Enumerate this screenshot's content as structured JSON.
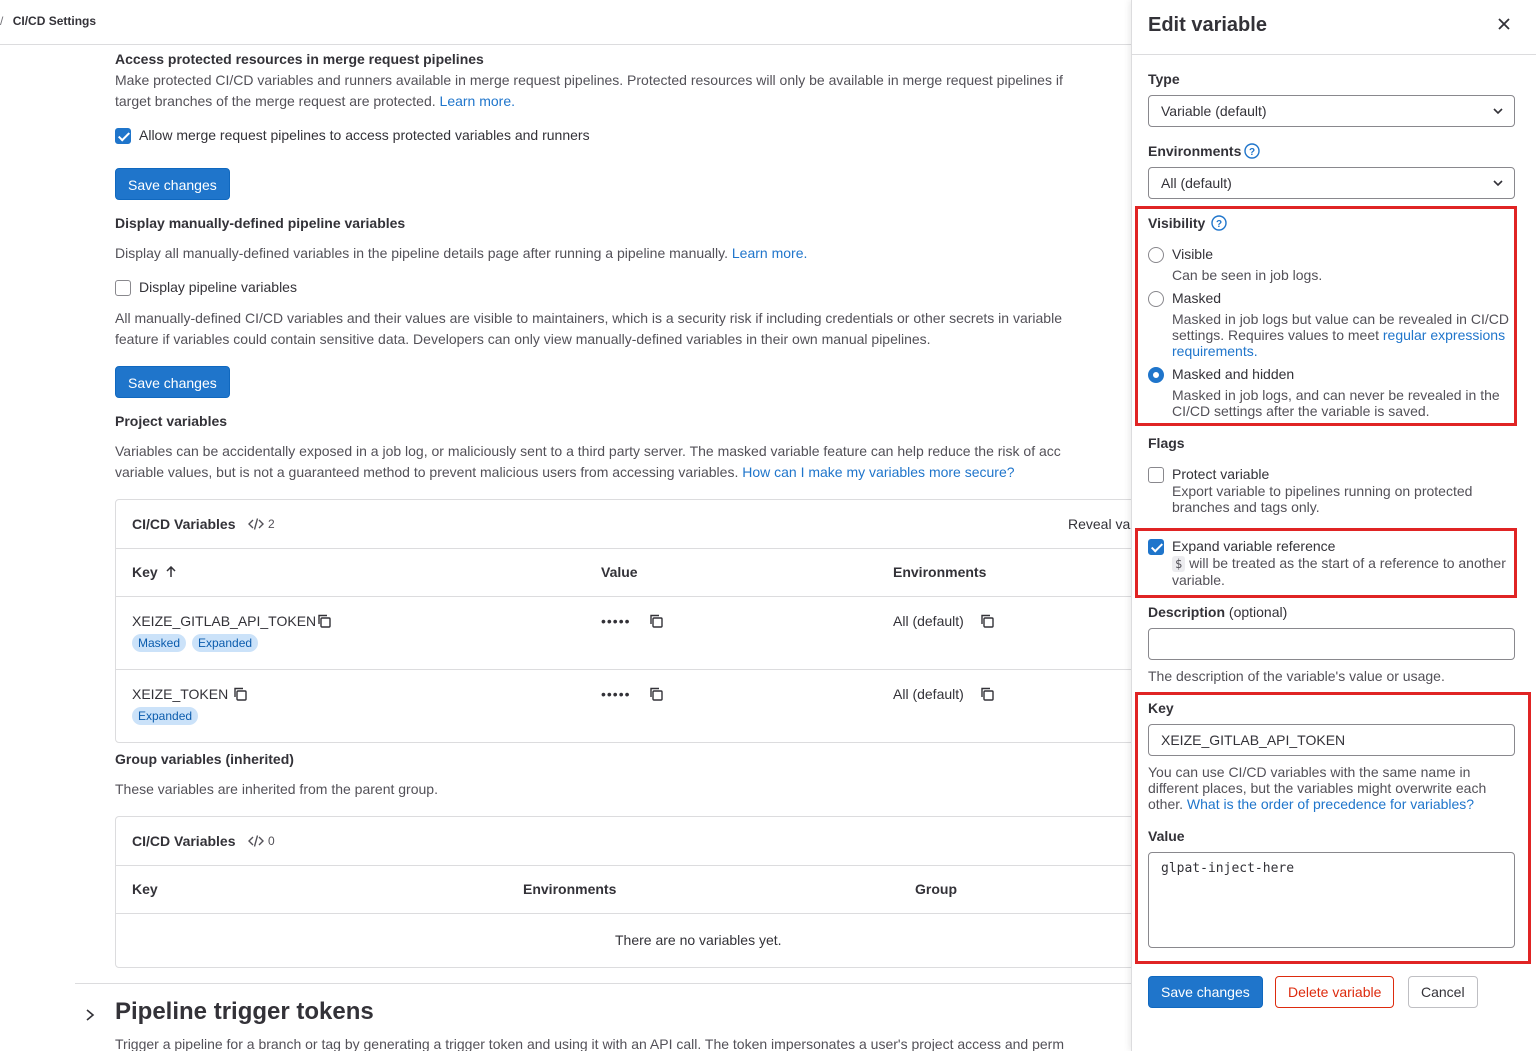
{
  "breadcrumb": {
    "separator": "/",
    "current": "CI/CD Settings"
  },
  "merge_request": {
    "title": "Access protected resources in merge request pipelines",
    "desc_line1": "Make protected CI/CD variables and runners available in merge request pipelines. Protected resources will only be available in merge request pipelines if",
    "desc_line2": "target branches of the merge request are protected.",
    "learn_more": "Learn more.",
    "checkbox_label": "Allow merge request pipelines to access protected variables and runners",
    "checkbox_checked": true,
    "save_label": "Save changes"
  },
  "pipeline_vars": {
    "title": "Display manually-defined pipeline variables",
    "desc": "Display all manually-defined variables in the pipeline details page after running a pipeline manually.",
    "learn_more": "Learn more.",
    "checkbox_label": "Display pipeline variables",
    "checkbox_checked": false,
    "warn_line1": "All manually-defined CI/CD variables and their values are visible to maintainers, which is a security risk if including credentials or other secrets in variable",
    "warn_line2": "feature if variables could contain sensitive data. Developers can only view manually-defined variables in their own manual pipelines.",
    "save_label": "Save changes"
  },
  "project_vars": {
    "title": "Project variables",
    "desc_line1": "Variables can be accidentally exposed in a job log, or maliciously sent to a third party server. The masked variable feature can help reduce the risk of acc",
    "desc_line2": "variable values, but is not a guaranteed method to prevent malicious users from accessing variables.",
    "secure_link": "How can I make my variables more secure?",
    "card_title": "CI/CD Variables",
    "count": "2",
    "reveal": "Reveal va",
    "columns": {
      "key": "Key",
      "value": "Value",
      "environments": "Environments"
    },
    "rows": [
      {
        "key": "XEIZE_GITLAB_API_TOKEN",
        "value": "•••••",
        "env": "All (default)",
        "badges": [
          "Masked",
          "Expanded"
        ]
      },
      {
        "key": "XEIZE_TOKEN",
        "value": "•••••",
        "env": "All (default)",
        "badges": [
          "Expanded"
        ]
      }
    ]
  },
  "group_vars": {
    "title": "Group variables (inherited)",
    "desc": "These variables are inherited from the parent group.",
    "card_title": "CI/CD Variables",
    "count": "0",
    "columns": {
      "key": "Key",
      "environments": "Environments",
      "group": "Group"
    },
    "empty": "There are no variables yet."
  },
  "trigger": {
    "title": "Pipeline trigger tokens",
    "desc": "Trigger a pipeline for a branch or tag by generating a trigger token and using it with an API call. The token impersonates a user's project access and perm"
  },
  "drawer": {
    "title": "Edit variable",
    "type_label": "Type",
    "type_value": "Variable (default)",
    "env_label": "Environments",
    "env_value": "All (default)",
    "visibility_label": "Visibility",
    "visibility_options": [
      {
        "title": "Visible",
        "help": "Can be seen in job logs.",
        "selected": false
      },
      {
        "title": "Masked",
        "help": "Masked in job logs but value can be revealed in CI/CD settings. Requires values to meet",
        "link": "regular expressions requirements.",
        "selected": false
      },
      {
        "title": "Masked and hidden",
        "help": "Masked in job logs, and can never be revealed in the CI/CD settings after the variable is saved.",
        "selected": true
      }
    ],
    "flags_label": "Flags",
    "protect": {
      "title": "Protect variable",
      "help": "Export variable to pipelines running on protected branches and tags only.",
      "checked": false
    },
    "expand": {
      "title": "Expand variable reference",
      "chip": "$",
      "help": "will be treated as the start of a reference to another variable.",
      "checked": true
    },
    "description_label": "Description",
    "description_optional": "(optional)",
    "description_value": "",
    "description_help": "The description of the variable's value or usage.",
    "key_label": "Key",
    "key_value": "XEIZE_GITLAB_API_TOKEN",
    "key_help": "You can use CI/CD variables with the same name in different places, but the variables might overwrite each other.",
    "key_link": "What is the order of precedence for variables?",
    "value_label": "Value",
    "value_value": "glpat-inject-here",
    "save_label": "Save changes",
    "delete_label": "Delete variable",
    "cancel_label": "Cancel"
  },
  "colors": {
    "primary": "#1f75cb",
    "danger": "#dd2b0e",
    "highlight": "#e02424",
    "badge_bg": "#cbe2f9"
  },
  "icons": [
    "copy-icon",
    "code-icon",
    "sort-arrow-up-icon",
    "chevron-down-icon",
    "help-icon",
    "close-icon",
    "chevron-right-icon"
  ]
}
